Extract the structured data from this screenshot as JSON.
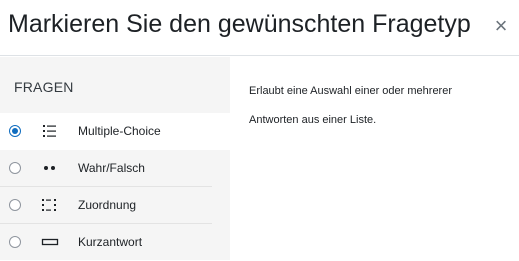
{
  "dialog": {
    "title": "Markieren Sie den gewünschten Fragetyp",
    "close_icon": "close-icon"
  },
  "sidebar": {
    "section_label": "FRAGEN",
    "options": [
      {
        "label": "Multiple-Choice",
        "icon": "list-bullets-icon",
        "selected": true
      },
      {
        "label": "Wahr/Falsch",
        "icon": "two-dots-icon",
        "selected": false
      },
      {
        "label": "Zuordnung",
        "icon": "matching-grid-icon",
        "selected": false
      },
      {
        "label": "Kurzantwort",
        "icon": "short-answer-box-icon",
        "selected": false
      }
    ]
  },
  "description": {
    "text": "Erlaubt eine Auswahl einer oder mehrerer Antworten aus einer Liste."
  },
  "colors": {
    "accent": "#0f6cbf",
    "sidebar_bg": "#f5f5f5"
  }
}
